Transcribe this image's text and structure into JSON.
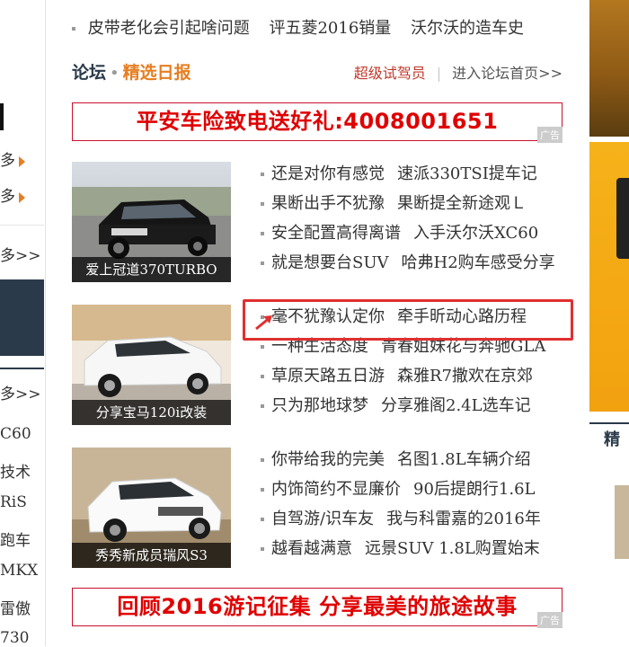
{
  "left_column": {
    "items": [
      {
        "text": "多"
      },
      {
        "text": "多"
      },
      {
        "text": "多>>"
      },
      {
        "text": "多>>"
      },
      {
        "text": "C60"
      },
      {
        "text": "技术"
      },
      {
        "text": "RiS"
      },
      {
        "text": "跑车"
      },
      {
        "text": "MKX"
      },
      {
        "text": "雷傲"
      },
      {
        "text": "730"
      }
    ]
  },
  "top_links": [
    "皮带老化会引起啥问题",
    "评五菱2016销量",
    "沃尔沃的造车史"
  ],
  "forum": {
    "title": "论坛",
    "subtitle": "精选日报",
    "link_test_driver": "超级试驾员",
    "link_enter": "进入论坛首页>>"
  },
  "banners": [
    {
      "text": "平安车险致电送好礼:4008001651",
      "ad": "广告"
    },
    {
      "text": "回顾2016游记征集 分享最美的旅途故事",
      "ad": "广告"
    }
  ],
  "blocks": [
    {
      "caption": "爱上冠道370TURBO",
      "links": [
        [
          "还是对你有感觉",
          "速派330TSI提车记"
        ],
        [
          "果断出手不犹豫",
          "果断提全新途观Ｌ"
        ],
        [
          "安全配置高得离谱",
          "入手沃尔沃XC60"
        ],
        [
          "就是想要台SUV",
          "哈弗H2购车感受分享"
        ]
      ]
    },
    {
      "caption": "分享宝马120i改装",
      "links": [
        [
          "毫不犹豫认定你",
          "牵手昕动心路历程"
        ],
        [
          "一种生活态度",
          "青春姐妹花与奔驰GLA"
        ],
        [
          "草原天路五日游",
          "森雅R7撒欢在京郊"
        ],
        [
          "只为那地球梦",
          "分享雅阁2.4L选车记"
        ]
      ]
    },
    {
      "caption": "秀秀新成员瑞风S3",
      "links": [
        [
          "你带给我的完美",
          "名图1.8L车辆介绍"
        ],
        [
          "内饰简约不显廉价",
          "90后提朗行1.6L"
        ],
        [
          "自驾游/识车友",
          "我与科雷嘉的2016年"
        ],
        [
          "越看越满意",
          "远景SUV 1.8L购置始末"
        ]
      ]
    }
  ],
  "right_column": {
    "label": "精"
  },
  "colors": {
    "accent_orange": "#e67e22",
    "brand_navy": "#2b3a4a",
    "banner_red": "#e00000",
    "highlight_red": "#e03030"
  }
}
